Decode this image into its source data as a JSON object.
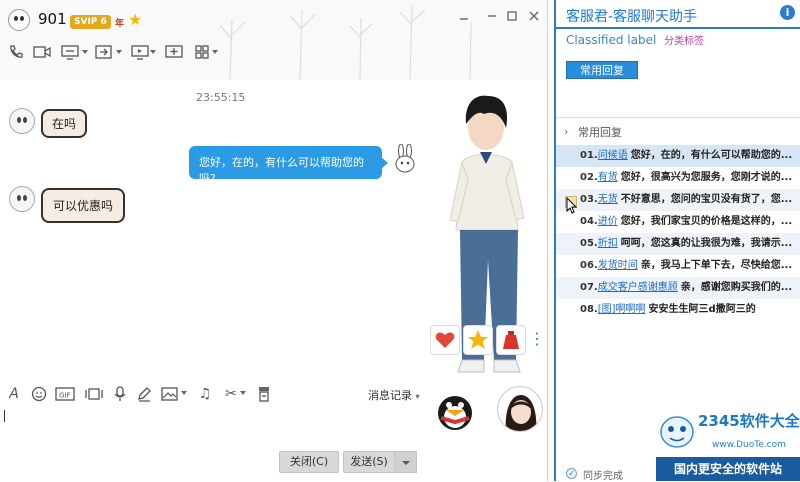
{
  "contact": {
    "name": "901",
    "vip": "SVIP 6",
    "year": "年"
  },
  "window_controls": [
    "—",
    "□",
    "✕"
  ],
  "chat": {
    "timestamp": "23:55:15",
    "messages": [
      {
        "side": "in",
        "text": "在吗"
      },
      {
        "side": "out",
        "text": "您好，在的，有什么可以帮助您的吗?"
      },
      {
        "side": "in",
        "text": "可以优惠吗"
      }
    ]
  },
  "toolbar_top": [
    "phone-icon",
    "video-icon",
    "screen-share-icon",
    "file-transfer-icon",
    "remote-desktop-icon",
    "app-add-icon",
    "apps-grid-icon"
  ],
  "toolbar_bottom": [
    "font-icon",
    "emoji-icon",
    "gif-icon",
    "video-clip-icon",
    "voice-icon",
    "pencil-icon",
    "image-icon",
    "music-icon",
    "scissors-icon",
    "trash-icon"
  ],
  "gifts": [
    "heart-gift",
    "star-gift",
    "lucky-bag-gift",
    "more"
  ],
  "history_label": "消息记录",
  "buttons": {
    "close": "关闭(C)",
    "send": "发送(S)"
  },
  "assistant": {
    "title": "客服君-客服聊天助手",
    "classified": "Classified",
    "label_word": "label",
    "label_zh": "分类标签",
    "common_reply_button": "常用回复",
    "section_header": "常用回复",
    "sync_status": "同步完成",
    "replies": [
      {
        "num": "01.",
        "key": "问候语",
        "text": "您好，在的，有什么可以帮助您的..."
      },
      {
        "num": "02.",
        "key": "有货",
        "text": "您好，很高兴为您服务，您刚才说的..."
      },
      {
        "num": "03.",
        "key": "无货",
        "text": "不好意思，您问的宝贝没有货了，您..."
      },
      {
        "num": "04.",
        "key": "进价",
        "text": "您好，我们家宝贝的价格是这样的，..."
      },
      {
        "num": "05.",
        "key": "折扣",
        "text": "呵呵，您这真的让我很为难，我请示..."
      },
      {
        "num": "06.",
        "key": "发货时间",
        "text": "亲，我马上下单下去，尽快给您..."
      },
      {
        "num": "07.",
        "key": "成交客户感谢惠顾",
        "text": "亲，感谢您购买我们的..."
      },
      {
        "num": "08.",
        "key": "[图]啊啊啊",
        "text": "安安生生阿三d撒阿三的"
      }
    ]
  },
  "watermark": {
    "logo": "2345软件大全",
    "url": "www.DuoTe.com",
    "tagline": "国内更安全的软件站"
  },
  "colors": {
    "accent": "#2b9be6",
    "panel_blue": "#2d7bc4"
  }
}
